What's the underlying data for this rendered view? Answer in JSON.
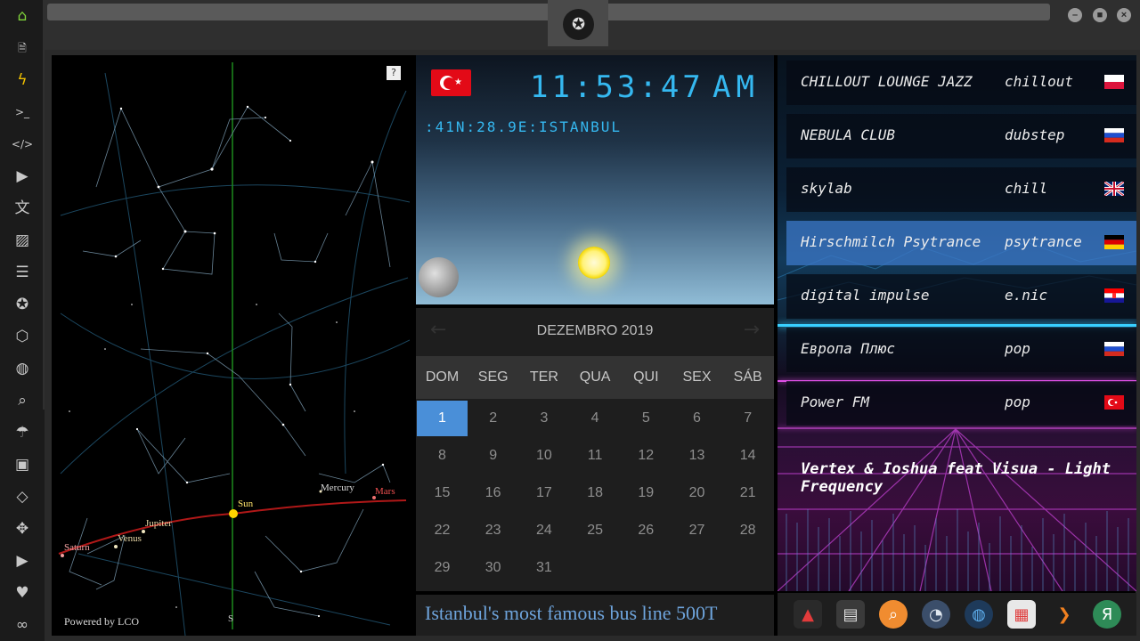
{
  "sidebar": {
    "items": [
      {
        "icon": "home-icon",
        "glyph": "⌂"
      },
      {
        "icon": "document-icon",
        "glyph": "🗎"
      },
      {
        "icon": "lightning-icon",
        "glyph": "ϟ"
      },
      {
        "icon": "terminal-icon",
        "glyph": ">_"
      },
      {
        "icon": "code-icon",
        "glyph": "</>"
      },
      {
        "icon": "play-icon",
        "glyph": "▶"
      },
      {
        "icon": "translate-icon",
        "glyph": "文"
      },
      {
        "icon": "image-icon",
        "glyph": "▨"
      },
      {
        "icon": "news-icon",
        "glyph": "☰"
      },
      {
        "icon": "rebel-icon",
        "glyph": "✪"
      },
      {
        "icon": "cube-icon",
        "glyph": "⬡"
      },
      {
        "icon": "globe-icon",
        "glyph": "◍"
      },
      {
        "icon": "search-icon",
        "glyph": "⌕"
      },
      {
        "icon": "umbrella-icon",
        "glyph": "☂"
      },
      {
        "icon": "contact-icon",
        "glyph": "▣"
      },
      {
        "icon": "tag-icon",
        "glyph": "◇"
      },
      {
        "icon": "expand-icon",
        "glyph": "✥"
      },
      {
        "icon": "youtube-icon",
        "glyph": "▶"
      },
      {
        "icon": "heart-icon",
        "glyph": "♥"
      },
      {
        "icon": "infinity-icon",
        "glyph": "∞"
      }
    ]
  },
  "window": {
    "minimize": "–",
    "maximize": "■",
    "close": "×"
  },
  "skymap": {
    "help": "?",
    "powered_by": "Powered by LCO",
    "labels": {
      "sun": "Sun",
      "mercury": "Mercury",
      "mars": "Mars",
      "jupiter": "Jupiter",
      "venus": "Venus",
      "saturn": "Saturn",
      "south": "S"
    }
  },
  "clock": {
    "time": "11:53:47",
    "ampm": "AM",
    "location": ":41N:28.9E:ISTANBUL"
  },
  "calendar": {
    "title": "DEZEMBRO 2019",
    "prev": "←",
    "next": "→",
    "weekdays": [
      "DOM",
      "SEG",
      "TER",
      "QUA",
      "QUI",
      "SEX",
      "SÁB"
    ],
    "first_weekday": 0,
    "days": [
      "1",
      "2",
      "3",
      "4",
      "5",
      "6",
      "7",
      "8",
      "9",
      "10",
      "11",
      "12",
      "13",
      "14",
      "15",
      "16",
      "17",
      "18",
      "19",
      "20",
      "21",
      "22",
      "23",
      "24",
      "25",
      "26",
      "27",
      "28",
      "29",
      "30",
      "31"
    ],
    "selected": "1"
  },
  "caption": "Istanbul's most famous bus line 500T",
  "radio": {
    "stations": [
      {
        "name": "CHILLOUT LOUNGE JAZZ",
        "genre": "chillout",
        "flag": "PL"
      },
      {
        "name": "NEBULA CLUB",
        "genre": "dubstep",
        "flag": "RU"
      },
      {
        "name": "skylab",
        "genre": "chill",
        "flag": "GB"
      },
      {
        "name": "Hirschmilch Psytrance",
        "genre": "psytrance",
        "flag": "DE"
      },
      {
        "name": "digital impulse",
        "genre": "e.nic",
        "flag": "HR"
      },
      {
        "name": "Европа Плюс",
        "genre": "pop",
        "flag": "RU"
      },
      {
        "name": "Power FM",
        "genre": "pop",
        "flag": "TR"
      }
    ],
    "active_index": 3,
    "now_playing": "Vertex & Ioshua feat Visua - Light Frequency"
  },
  "dock": {
    "items": [
      {
        "icon": "app-a-icon",
        "glyph": "▲",
        "color": "#e23b3b",
        "bg": "#2a2a2a"
      },
      {
        "icon": "news-app-icon",
        "glyph": "▤",
        "color": "#e0e0e0",
        "bg": "#3a3a3a"
      },
      {
        "icon": "magnifier-app-icon",
        "glyph": "⌕",
        "color": "#ffffff",
        "bg": "#f08c30"
      },
      {
        "icon": "clock-app-icon",
        "glyph": "◔",
        "color": "#dfe6ee",
        "bg": "#3b4e6a"
      },
      {
        "icon": "globe-app-icon",
        "glyph": "◍",
        "color": "#5fb0f0",
        "bg": "#1e3a5a"
      },
      {
        "icon": "calendar-app-icon",
        "glyph": "▦",
        "color": "#e04040",
        "bg": "#e8e8e8"
      },
      {
        "icon": "arrow-app-icon",
        "glyph": "❯",
        "color": "#f08020",
        "bg": "#1e1e1e"
      },
      {
        "icon": "yandex-app-icon",
        "glyph": "Я",
        "color": "#ffffff",
        "bg": "#2e8b57"
      }
    ]
  },
  "colors": {
    "accent": "#35b8f0",
    "selected_day": "#4a8fd8",
    "sun_path": "#b01818"
  }
}
